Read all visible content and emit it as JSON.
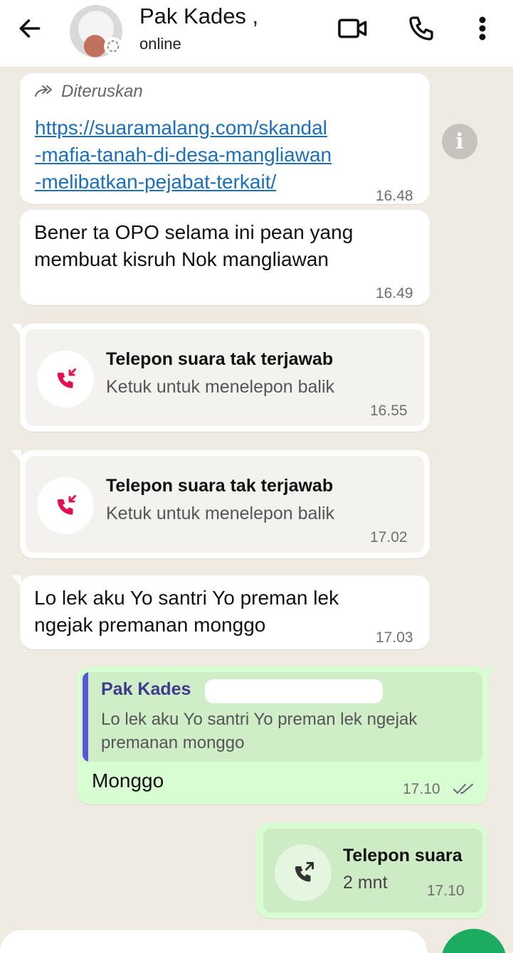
{
  "header": {
    "contact_name": "Pak Kades ,",
    "status": "online"
  },
  "messages": {
    "m1": {
      "forwarded_label": "Diteruskan",
      "link_lines": [
        "https://suaramalang.com/skandal",
        "-mafia-tanah-di-desa-mangliawan",
        "-melibatkan-pejabat-terkait/"
      ],
      "time": "16.48"
    },
    "m2": {
      "lines": [
        "Bener ta OPO selama ini pean yang",
        "membuat kisruh Nok mangliawan"
      ],
      "time": "16.49"
    },
    "m3": {
      "title": "Telepon suara tak terjawab",
      "subtitle": "Ketuk untuk menelepon balik",
      "time": "16.55"
    },
    "m4": {
      "title": "Telepon suara tak terjawab",
      "subtitle": "Ketuk untuk menelepon balik",
      "time": "17.02"
    },
    "m5": {
      "lines": [
        "Lo lek aku Yo santri Yo preman lek",
        "ngejak premanan monggo"
      ],
      "time": "17.03"
    },
    "m6": {
      "quote_name": "Pak Kades",
      "quote_text": "Lo lek aku Yo santri Yo preman lek ngejak premanan monggo",
      "text": "Monggo",
      "time": "17.10"
    },
    "m7": {
      "title": "Telepon suara",
      "duration": "2 mnt",
      "time": "17.10"
    }
  },
  "colors": {
    "incoming_bubble": "#ffffff",
    "outgoing_bubble": "#d9fdd3",
    "chat_background": "#efeae2",
    "missed_call": "#e0114d",
    "link": "#1c6fb8",
    "fab": "#1daa61"
  }
}
